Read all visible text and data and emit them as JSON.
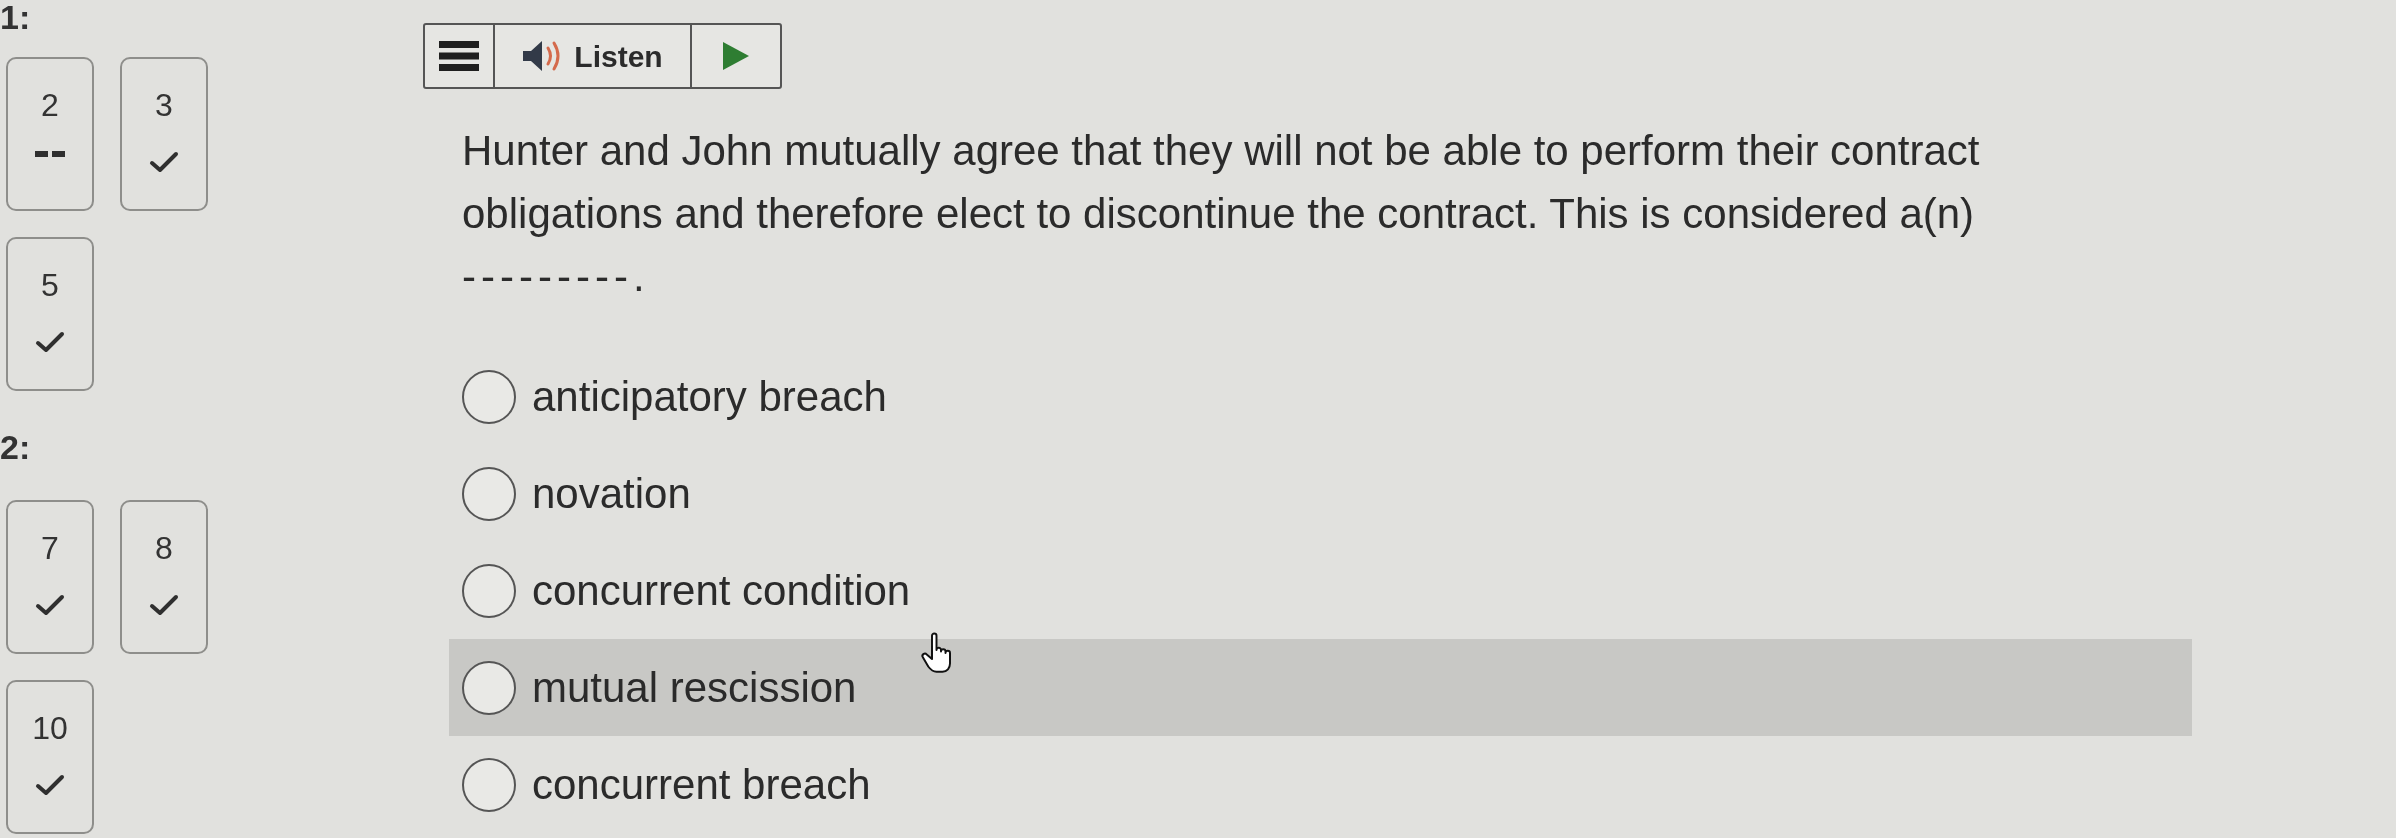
{
  "sections": [
    {
      "label": "1:",
      "tiles": [
        {
          "number": "2",
          "answered": false
        },
        {
          "number": "3",
          "answered": true
        },
        {
          "number": "5",
          "answered": true
        }
      ]
    },
    {
      "label": "2:",
      "tiles": [
        {
          "number": "7",
          "answered": true
        },
        {
          "number": "8",
          "answered": true
        },
        {
          "number": "10",
          "answered": true
        }
      ]
    }
  ],
  "toolbar": {
    "listen_label": "Listen"
  },
  "question": {
    "text": "Hunter and John mutually agree that they will not be able to perform their contract obligations and therefore elect to discontinue the contract. This is considered a(n)",
    "blank": "---------."
  },
  "options": [
    {
      "label": "anticipatory breach",
      "selected": false,
      "hovered": false
    },
    {
      "label": "novation",
      "selected": false,
      "hovered": false
    },
    {
      "label": "concurrent condition",
      "selected": false,
      "hovered": false
    },
    {
      "label": "mutual rescission",
      "selected": false,
      "hovered": true
    },
    {
      "label": "concurrent breach",
      "selected": false,
      "hovered": false
    }
  ]
}
